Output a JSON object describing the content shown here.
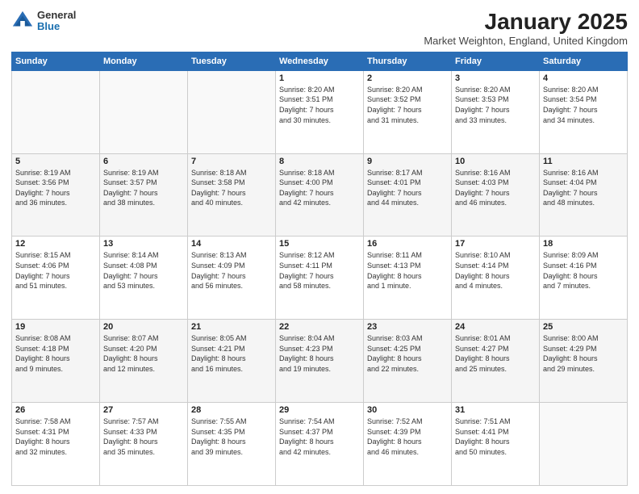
{
  "logo": {
    "general": "General",
    "blue": "Blue"
  },
  "title": {
    "month": "January 2025",
    "location": "Market Weighton, England, United Kingdom"
  },
  "weekdays": [
    "Sunday",
    "Monday",
    "Tuesday",
    "Wednesday",
    "Thursday",
    "Friday",
    "Saturday"
  ],
  "weeks": [
    [
      {
        "day": "",
        "info": ""
      },
      {
        "day": "",
        "info": ""
      },
      {
        "day": "",
        "info": ""
      },
      {
        "day": "1",
        "info": "Sunrise: 8:20 AM\nSunset: 3:51 PM\nDaylight: 7 hours\nand 30 minutes."
      },
      {
        "day": "2",
        "info": "Sunrise: 8:20 AM\nSunset: 3:52 PM\nDaylight: 7 hours\nand 31 minutes."
      },
      {
        "day": "3",
        "info": "Sunrise: 8:20 AM\nSunset: 3:53 PM\nDaylight: 7 hours\nand 33 minutes."
      },
      {
        "day": "4",
        "info": "Sunrise: 8:20 AM\nSunset: 3:54 PM\nDaylight: 7 hours\nand 34 minutes."
      }
    ],
    [
      {
        "day": "5",
        "info": "Sunrise: 8:19 AM\nSunset: 3:56 PM\nDaylight: 7 hours\nand 36 minutes."
      },
      {
        "day": "6",
        "info": "Sunrise: 8:19 AM\nSunset: 3:57 PM\nDaylight: 7 hours\nand 38 minutes."
      },
      {
        "day": "7",
        "info": "Sunrise: 8:18 AM\nSunset: 3:58 PM\nDaylight: 7 hours\nand 40 minutes."
      },
      {
        "day": "8",
        "info": "Sunrise: 8:18 AM\nSunset: 4:00 PM\nDaylight: 7 hours\nand 42 minutes."
      },
      {
        "day": "9",
        "info": "Sunrise: 8:17 AM\nSunset: 4:01 PM\nDaylight: 7 hours\nand 44 minutes."
      },
      {
        "day": "10",
        "info": "Sunrise: 8:16 AM\nSunset: 4:03 PM\nDaylight: 7 hours\nand 46 minutes."
      },
      {
        "day": "11",
        "info": "Sunrise: 8:16 AM\nSunset: 4:04 PM\nDaylight: 7 hours\nand 48 minutes."
      }
    ],
    [
      {
        "day": "12",
        "info": "Sunrise: 8:15 AM\nSunset: 4:06 PM\nDaylight: 7 hours\nand 51 minutes."
      },
      {
        "day": "13",
        "info": "Sunrise: 8:14 AM\nSunset: 4:08 PM\nDaylight: 7 hours\nand 53 minutes."
      },
      {
        "day": "14",
        "info": "Sunrise: 8:13 AM\nSunset: 4:09 PM\nDaylight: 7 hours\nand 56 minutes."
      },
      {
        "day": "15",
        "info": "Sunrise: 8:12 AM\nSunset: 4:11 PM\nDaylight: 7 hours\nand 58 minutes."
      },
      {
        "day": "16",
        "info": "Sunrise: 8:11 AM\nSunset: 4:13 PM\nDaylight: 8 hours\nand 1 minute."
      },
      {
        "day": "17",
        "info": "Sunrise: 8:10 AM\nSunset: 4:14 PM\nDaylight: 8 hours\nand 4 minutes."
      },
      {
        "day": "18",
        "info": "Sunrise: 8:09 AM\nSunset: 4:16 PM\nDaylight: 8 hours\nand 7 minutes."
      }
    ],
    [
      {
        "day": "19",
        "info": "Sunrise: 8:08 AM\nSunset: 4:18 PM\nDaylight: 8 hours\nand 9 minutes."
      },
      {
        "day": "20",
        "info": "Sunrise: 8:07 AM\nSunset: 4:20 PM\nDaylight: 8 hours\nand 12 minutes."
      },
      {
        "day": "21",
        "info": "Sunrise: 8:05 AM\nSunset: 4:21 PM\nDaylight: 8 hours\nand 16 minutes."
      },
      {
        "day": "22",
        "info": "Sunrise: 8:04 AM\nSunset: 4:23 PM\nDaylight: 8 hours\nand 19 minutes."
      },
      {
        "day": "23",
        "info": "Sunrise: 8:03 AM\nSunset: 4:25 PM\nDaylight: 8 hours\nand 22 minutes."
      },
      {
        "day": "24",
        "info": "Sunrise: 8:01 AM\nSunset: 4:27 PM\nDaylight: 8 hours\nand 25 minutes."
      },
      {
        "day": "25",
        "info": "Sunrise: 8:00 AM\nSunset: 4:29 PM\nDaylight: 8 hours\nand 29 minutes."
      }
    ],
    [
      {
        "day": "26",
        "info": "Sunrise: 7:58 AM\nSunset: 4:31 PM\nDaylight: 8 hours\nand 32 minutes."
      },
      {
        "day": "27",
        "info": "Sunrise: 7:57 AM\nSunset: 4:33 PM\nDaylight: 8 hours\nand 35 minutes."
      },
      {
        "day": "28",
        "info": "Sunrise: 7:55 AM\nSunset: 4:35 PM\nDaylight: 8 hours\nand 39 minutes."
      },
      {
        "day": "29",
        "info": "Sunrise: 7:54 AM\nSunset: 4:37 PM\nDaylight: 8 hours\nand 42 minutes."
      },
      {
        "day": "30",
        "info": "Sunrise: 7:52 AM\nSunset: 4:39 PM\nDaylight: 8 hours\nand 46 minutes."
      },
      {
        "day": "31",
        "info": "Sunrise: 7:51 AM\nSunset: 4:41 PM\nDaylight: 8 hours\nand 50 minutes."
      },
      {
        "day": "",
        "info": ""
      }
    ]
  ]
}
